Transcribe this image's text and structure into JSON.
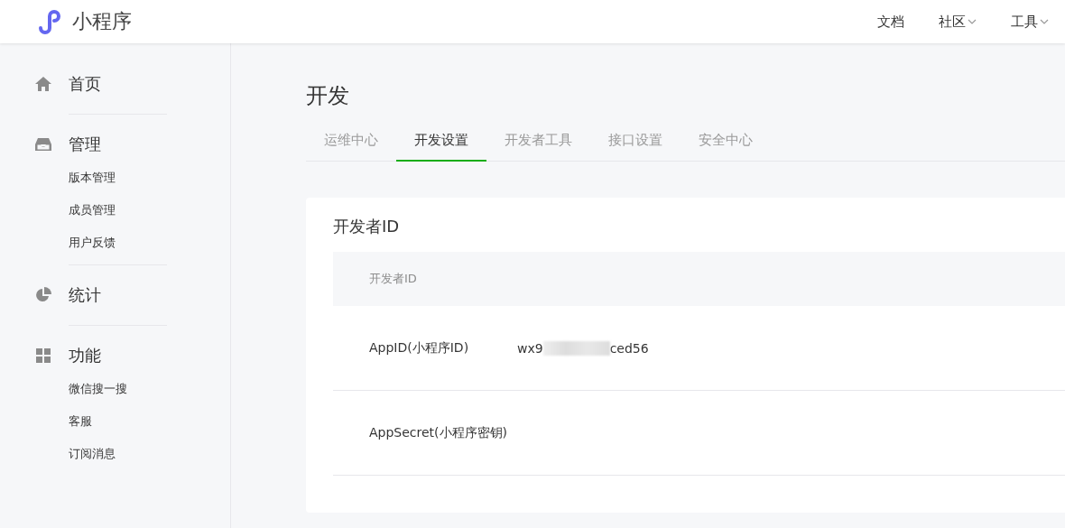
{
  "header": {
    "logo_text": "小程序",
    "nav": [
      {
        "label": "文档",
        "dropdown": false
      },
      {
        "label": "社区",
        "dropdown": true
      },
      {
        "label": "工具",
        "dropdown": true
      }
    ]
  },
  "sidebar": {
    "sections": [
      {
        "label": "首页"
      },
      {
        "label": "管理",
        "children": [
          {
            "label": "版本管理"
          },
          {
            "label": "成员管理"
          },
          {
            "label": "用户反馈"
          }
        ]
      },
      {
        "label": "统计"
      },
      {
        "label": "功能",
        "children": [
          {
            "label": "微信搜一搜"
          },
          {
            "label": "客服"
          },
          {
            "label": "订阅消息"
          }
        ]
      }
    ]
  },
  "page": {
    "title": "开发",
    "tabs": [
      {
        "label": "运维中心",
        "selected": false
      },
      {
        "label": "开发设置",
        "selected": true
      },
      {
        "label": "开发者工具",
        "selected": false
      },
      {
        "label": "接口设置",
        "selected": false
      },
      {
        "label": "安全中心",
        "selected": false
      }
    ]
  },
  "card": {
    "title": "开发者ID",
    "table": {
      "columns": [
        "开发者ID"
      ],
      "rows": [
        {
          "label": "AppID(小程序ID)",
          "value_prefix": "wx9",
          "value_suffix": "ced56",
          "redacted": true
        },
        {
          "label": "AppSecret(小程序密钥)"
        }
      ]
    }
  }
}
